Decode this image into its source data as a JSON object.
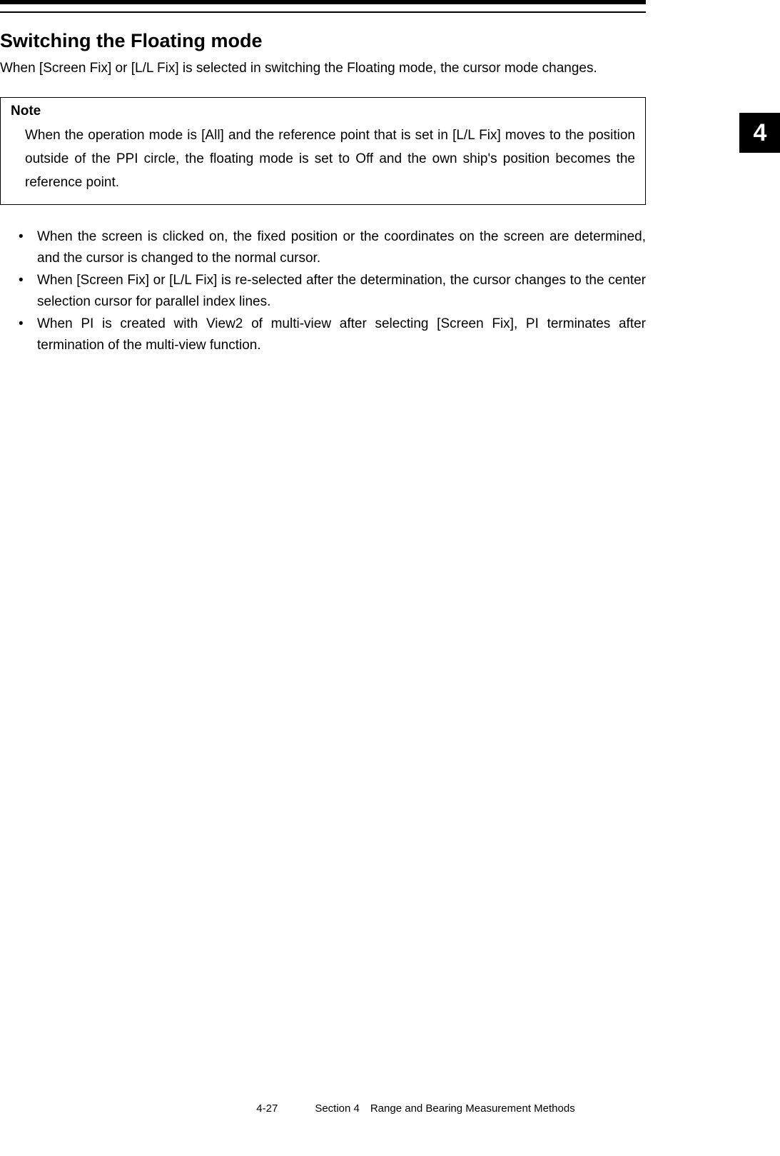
{
  "sideTab": "4",
  "title": "Switching the Floating mode",
  "intro": "When [Screen Fix] or [L/L Fix] is selected in switching the Floating mode, the cursor mode changes.",
  "note": {
    "heading": "Note",
    "body": "When the operation mode is [All] and the reference point that is set in [L/L Fix] moves to the position outside of the PPI circle, the floating mode is set to Off and the own ship's position becomes the reference point."
  },
  "bullets": [
    "When the screen is clicked on, the fixed position or the coordinates on the screen are determined, and the cursor is changed to the normal cursor.",
    "When [Screen Fix] or [L/L Fix] is re-selected after the determination, the cursor changes to the center selection cursor for parallel index lines.",
    "When PI is created with View2 of multi-view after selecting [Screen Fix], PI terminates after termination of the multi-view function."
  ],
  "footer": {
    "pageNum": "4-27",
    "sectionLabel": "Section 4 Range and Bearing Measurement Methods"
  }
}
